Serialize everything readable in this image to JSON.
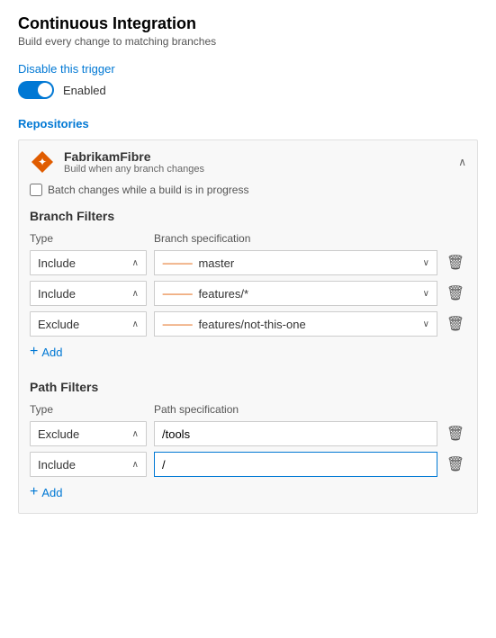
{
  "page": {
    "title": "Continuous Integration",
    "subtitle": "Build every change to matching branches"
  },
  "trigger": {
    "disable_label": "Disable this trigger",
    "toggle_state": "enabled",
    "toggle_label": "Enabled"
  },
  "repositories_section": {
    "title": "Repositories",
    "repo": {
      "name": "FabrikamFibre",
      "description": "Build when any branch changes",
      "batch_label": "Batch changes while a build is in progress"
    }
  },
  "branch_filters": {
    "title": "Branch Filters",
    "type_col": "Type",
    "spec_col": "Branch specification",
    "rows": [
      {
        "type": "Include",
        "spec": "master"
      },
      {
        "type": "Include",
        "spec": "features/*"
      },
      {
        "type": "Exclude",
        "spec": "features/not-this-one"
      }
    ],
    "add_label": "Add"
  },
  "path_filters": {
    "title": "Path Filters",
    "type_col": "Type",
    "spec_col": "Path specification",
    "rows": [
      {
        "type": "Exclude",
        "spec": "/tools",
        "focused": false
      },
      {
        "type": "Include",
        "spec": "/",
        "focused": true
      }
    ],
    "add_label": "Add"
  },
  "icons": {
    "branch": "⑂",
    "delete": "🗑",
    "chevron_down": "∨",
    "chevron_up": "∧",
    "add_plus": "+"
  }
}
